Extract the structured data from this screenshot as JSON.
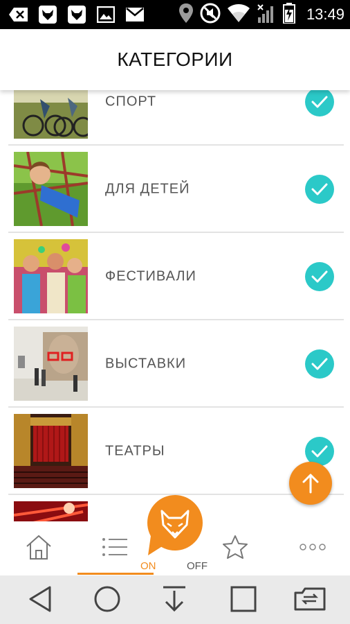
{
  "status_bar": {
    "time": "13:49",
    "icons": [
      "back-app-icon",
      "fox-notification-icon",
      "fox-notification-icon",
      "image-icon",
      "mail-icon",
      "location-icon",
      "mute-icon",
      "wifi-icon",
      "signal-icon",
      "battery-charging-icon"
    ]
  },
  "header": {
    "title": "КАТЕГОРИИ"
  },
  "categories": [
    {
      "label": "СПОРТ",
      "checked": true,
      "image": "sport-photo"
    },
    {
      "label": "ДЛЯ ДЕТЕЙ",
      "checked": true,
      "image": "kids-photo"
    },
    {
      "label": "ФЕСТИВАЛИ",
      "checked": true,
      "image": "festival-photo"
    },
    {
      "label": "ВЫСТАВКИ",
      "checked": true,
      "image": "exhibition-photo"
    },
    {
      "label": "ТЕАТРЫ",
      "checked": true,
      "image": "theatre-photo"
    },
    {
      "label": "",
      "checked": false,
      "image": "concert-photo"
    }
  ],
  "tab_bar": {
    "tabs": [
      "home-icon",
      "list-icon",
      "fox-toggle",
      "star-icon",
      "more-icon"
    ],
    "toggle_on": "ON",
    "toggle_off": "OFF",
    "active": "list"
  },
  "colors": {
    "accent": "#f28c1e",
    "check": "#2bc9c8",
    "divider": "#e3e3e3",
    "label": "#555555"
  },
  "nav_bar": {
    "buttons": [
      "back-icon",
      "home-icon",
      "download-icon",
      "recents-icon",
      "switch-sim-icon"
    ]
  }
}
